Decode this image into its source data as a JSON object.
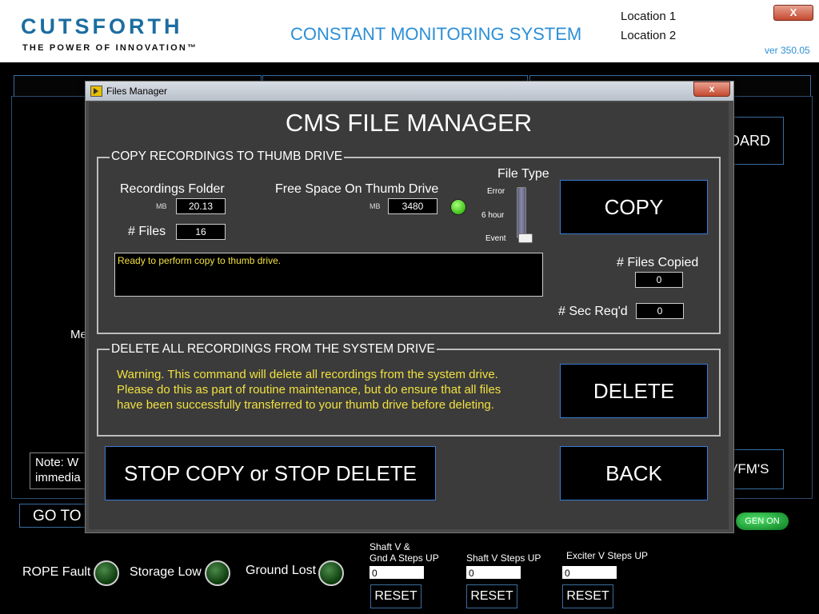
{
  "header": {
    "logo_name": "CUTSFORTH",
    "logo_tagline": "THE POWER OF INNOVATION™",
    "system_title": "CONSTANT MONITORING SYSTEM",
    "location1": "Location 1",
    "location2": "Location 2",
    "version": "ver 350.05",
    "close_label": "X"
  },
  "background": {
    "dashboard_label": "OARD",
    "wfms_label": "VFM'S",
    "note_text": "Note:  W immedia",
    "me_text": "Me",
    "goto_label": "GO TO",
    "gen_on_label": "GEN ON"
  },
  "status": {
    "rope_fault": "ROPE Fault",
    "storage_low": "Storage Low",
    "ground_lost": "Ground Lost",
    "steps": [
      {
        "label_line1": "Shaft V &",
        "label_line2": "Gnd A Steps UP",
        "value": "0",
        "reset": "RESET"
      },
      {
        "label_line1": "",
        "label_line2": "Shaft V Steps UP",
        "value": "0",
        "reset": "RESET"
      },
      {
        "label_line1": "",
        "label_line2": "Exciter V Steps UP",
        "value": "0",
        "reset": "RESET"
      }
    ]
  },
  "dialog": {
    "window_title": "Files Manager",
    "close_label": "x",
    "heading": "CMS FILE MANAGER",
    "copy_group": {
      "title": "COPY RECORDINGS TO THUMB DRIVE",
      "recordings_folder_label": "Recordings Folder",
      "recordings_unit": "MB",
      "recordings_value": "20.13",
      "files_label": "# Files",
      "files_value": "16",
      "free_space_label": "Free Space On Thumb Drive",
      "free_space_unit": "MB",
      "free_space_value": "3480",
      "file_type_label": "File Type",
      "file_type_options": [
        "Error",
        "6 hour",
        "Event"
      ],
      "file_type_selected": "Event",
      "status_message": "Ready to perform copy to thumb drive.",
      "copy_button": "COPY",
      "files_copied_label": "# Files Copied",
      "files_copied_value": "0",
      "sec_reqd_label": "# Sec Req'd",
      "sec_reqd_value": "0"
    },
    "delete_group": {
      "title": "DELETE ALL RECORDINGS FROM THE SYSTEM DRIVE",
      "warning_line1": "Warning.  This command will delete all recordings from the system drive.",
      "warning_line2": "Please do this as part of routine maintenance, but do ensure that all files",
      "warning_line3": "have been successfully transferred to your thumb drive before deleting.",
      "delete_button": "DELETE"
    },
    "stop_button": "STOP COPY or STOP DELETE",
    "back_button": "BACK"
  }
}
